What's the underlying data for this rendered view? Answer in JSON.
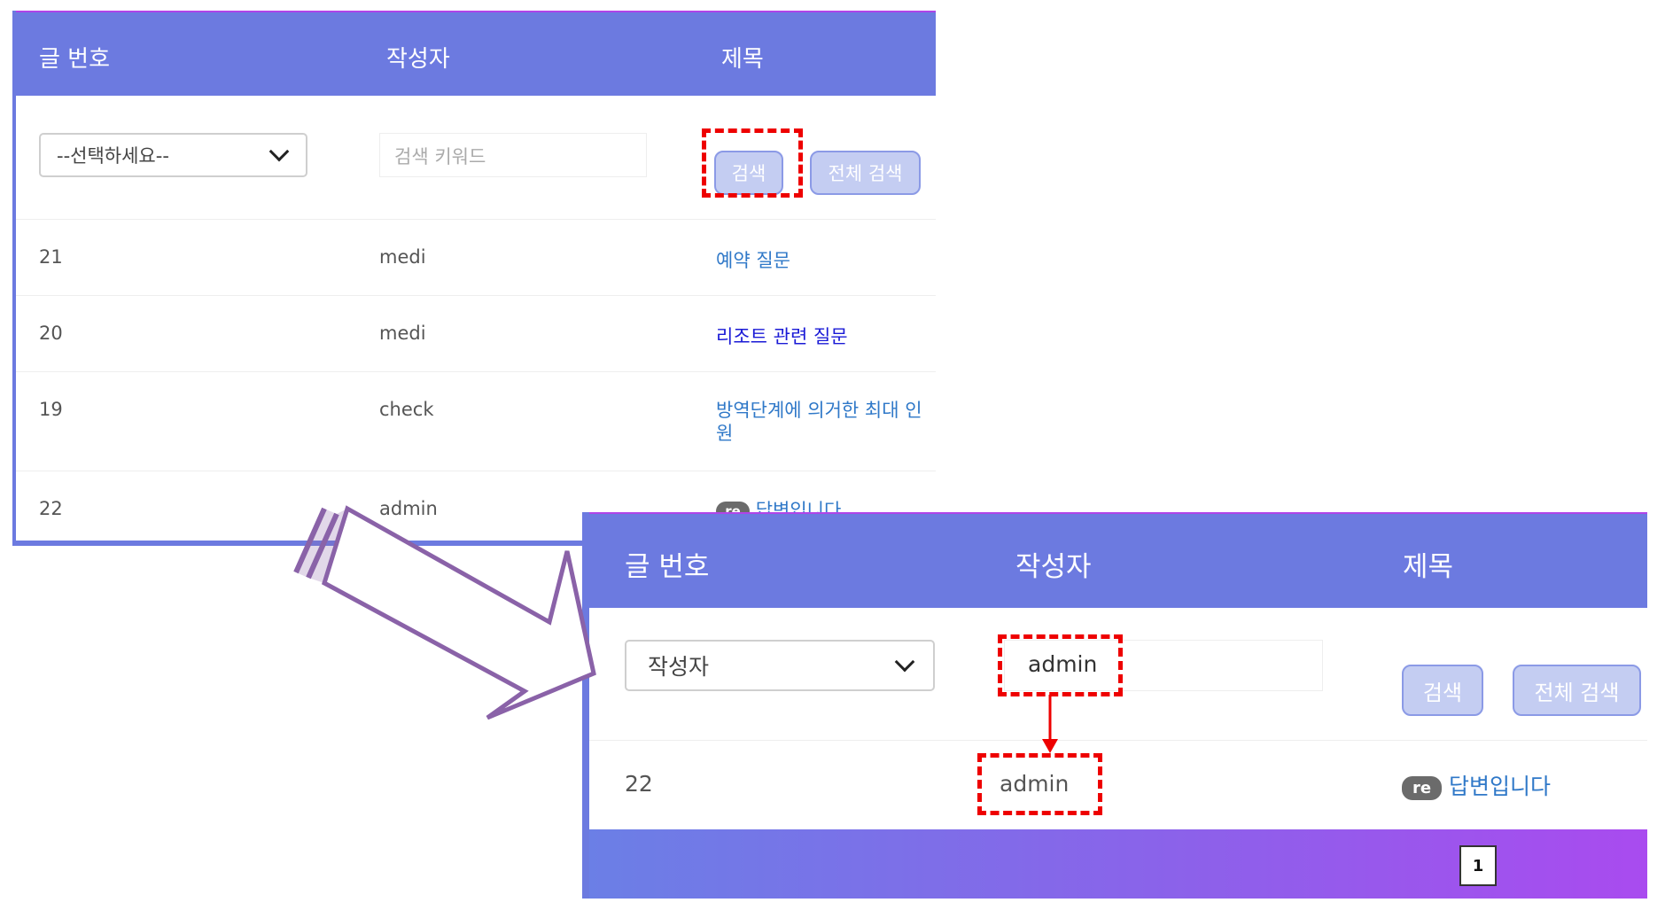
{
  "before": {
    "headers": {
      "no": "글 번호",
      "writer": "작성자",
      "title": "제목"
    },
    "search": {
      "select_value": "--선택하세요--",
      "keyword_placeholder": "검색 키워드",
      "search_label": "검색",
      "all_search_label": "전체 검색"
    },
    "rows": [
      {
        "no": "21",
        "writer": "medi",
        "title": "예약 질문"
      },
      {
        "no": "20",
        "writer": "medi",
        "title": "리조트 관련 질문"
      },
      {
        "no": "19",
        "writer": "check",
        "title": "방역단계에 의거한 최대 인원"
      },
      {
        "no": "22",
        "writer": "admin",
        "badge": "re",
        "title": "답변입니다"
      }
    ]
  },
  "after": {
    "headers": {
      "no": "글 번호",
      "writer": "작성자",
      "title": "제목"
    },
    "search": {
      "select_value": "작성자",
      "keyword_value": "admin",
      "search_label": "검색",
      "all_search_label": "전체 검색"
    },
    "rows": [
      {
        "no": "22",
        "writer": "admin",
        "badge": "re",
        "title": "답변입니다"
      }
    ],
    "pagination": {
      "current": "1"
    }
  },
  "colors": {
    "header": "#6c7ae0",
    "highlight": "#ee0000",
    "arrow": "#8a62a8",
    "button": "#c4cdf2"
  }
}
